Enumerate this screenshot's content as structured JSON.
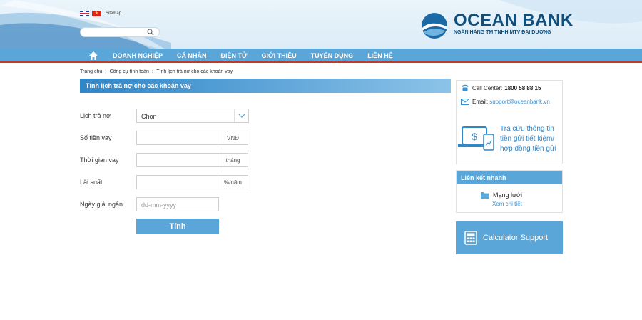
{
  "header": {
    "sitemap_label": "Sitemap",
    "logo_name": "OCEAN BANK",
    "logo_subtitle": "NGÂN HÀNG TM TNHH MTV ĐẠI DƯƠNG",
    "search_placeholder": ""
  },
  "nav": {
    "items": [
      "DOANH NGHIỆP",
      "CÁ NHÂN",
      "ĐIỆN TỬ",
      "GIỚI THIỆU",
      "TUYỂN DỤNG",
      "LIÊN HỆ"
    ]
  },
  "breadcrumb": [
    "Trang chủ",
    "Công cụ tính toán",
    "Tính lịch trả nợ cho các khoản vay"
  ],
  "page_title": "Tính lịch trả nợ cho các khoản vay",
  "form": {
    "schedule_label": "Lịch trả nợ",
    "schedule_value": "Chọn",
    "amount_label": "Số tiền vay",
    "amount_unit": "VNĐ",
    "term_label": "Thời gian vay",
    "term_unit": "tháng",
    "rate_label": "Lãi suất",
    "rate_unit": "%/năm",
    "date_label": "Ngày giải ngân",
    "date_placeholder": "dd-mm-yyyy",
    "submit_label": "Tính"
  },
  "sidebar": {
    "call_center_label": "Call Center:",
    "call_center_number": "1800 58 88 15",
    "email_label": "Email:",
    "email_value": "support@oceanbank.vn",
    "promo_lines": [
      "Tra cứu thông tin",
      "tiền gửi tiết kiệm/",
      "hợp đồng tiền gửi"
    ],
    "quick_links_title": "Liên kết nhanh",
    "network_label": "Mạng lưới",
    "network_detail": "Xem chi tiết",
    "calc_support_label": "Calculator Support"
  },
  "colors": {
    "nav_blue": "#5aa6d8",
    "brand_navy": "#0f4f7d",
    "accent_red": "#c0392b",
    "link_blue": "#3a8fd0"
  }
}
